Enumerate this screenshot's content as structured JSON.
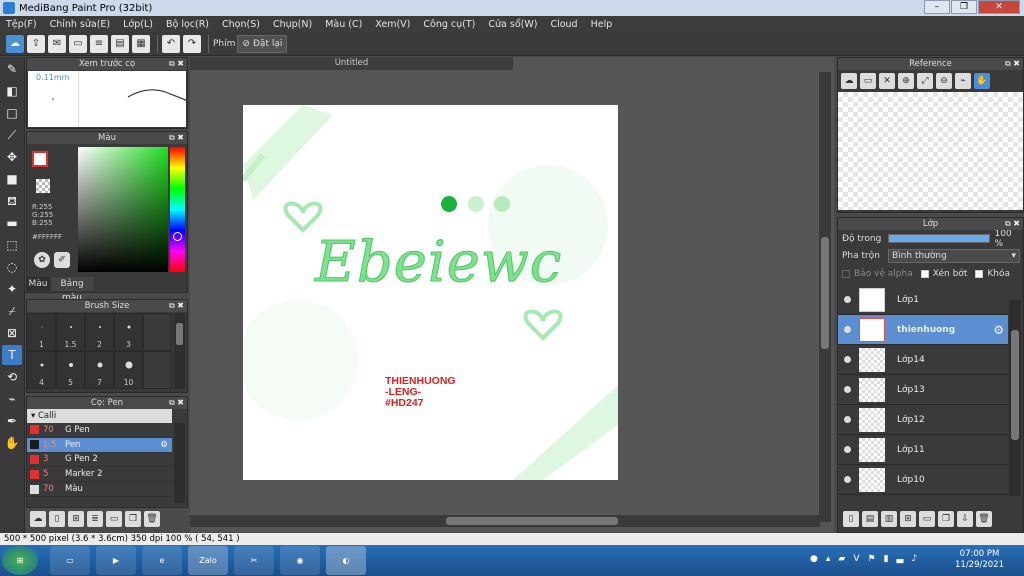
{
  "window": {
    "title": "MediBang Paint Pro (32bit)"
  },
  "menu": [
    "Tệp(F)",
    "Chỉnh sửa(E)",
    "Lớp(L)",
    "Bộ lọc(R)",
    "Chọn(S)",
    "Chụp(N)",
    "Màu (C)",
    "Xem(V)",
    "Công cụ(T)",
    "Cửa sổ(W)",
    "Cloud",
    "Help"
  ],
  "toolbar": {
    "phim_label": "Phím",
    "reset_label": "Đặt lại"
  },
  "brush_preview": {
    "title": "Xem trước cọ",
    "size_label": "0.11mm"
  },
  "color_panel": {
    "title": "Màu",
    "r": "R:255",
    "g": "G:255",
    "b": "B:255",
    "hex": "#FFFFFF",
    "tab_color": "Màu",
    "tab_palette": "Bảng màu"
  },
  "brush_size": {
    "title": "Brush Size",
    "sizes": [
      "1",
      "1.5",
      "2",
      "3",
      "4",
      "5",
      "7",
      "10"
    ]
  },
  "pen_panel": {
    "title": "Cọ: Pen",
    "group": "Calli",
    "items": [
      {
        "size": "70",
        "name": "G Pen",
        "color": "#e03030",
        "selected": false
      },
      {
        "size": "1.5",
        "name": "Pen",
        "color": "#1a1a1a",
        "selected": true
      },
      {
        "size": "3",
        "name": "G Pen 2",
        "color": "#e03030",
        "selected": false
      },
      {
        "size": "5",
        "name": "Marker 2",
        "color": "#e03030",
        "selected": false
      },
      {
        "size": "70",
        "name": "Màu",
        "color": "#dddddd",
        "selected": false
      }
    ]
  },
  "document": {
    "tab_title": "Untitled"
  },
  "artwork": {
    "word": "Ebeiewc",
    "text_lines": [
      "THIENHUONG",
      "-LENG-",
      "#HD247"
    ]
  },
  "reference_panel": {
    "title": "Reference"
  },
  "layer_panel": {
    "title": "Lớp",
    "opacity_label": "Độ trong",
    "opacity_value": "100 %",
    "opacity": 1.0,
    "blend_label": "Pha trộn",
    "blend_value": "Bình thường",
    "alpha_label": "Bảo vệ alpha",
    "clip_label": "Xén bớt",
    "lock_label": "Khóa",
    "layers": [
      {
        "name": "Lớp1",
        "selected": false
      },
      {
        "name": "thienhuong",
        "selected": true
      },
      {
        "name": "Lớp14",
        "selected": false
      },
      {
        "name": "Lớp13",
        "selected": false
      },
      {
        "name": "Lớp12",
        "selected": false
      },
      {
        "name": "Lớp11",
        "selected": false
      },
      {
        "name": "Lớp10",
        "selected": false
      }
    ]
  },
  "status_bar": {
    "text": "500 * 500 pixel  (3.6 * 3.6cm)  350 dpi  100 %  ( 54, 541 )"
  },
  "taskbar": {
    "time": "07:00 PM",
    "date": "11/29/2021",
    "zalo": "Zalo"
  },
  "colors": {
    "accent": "#5b8fd1",
    "panel_bg": "#3a3a3a",
    "art_green": "#7fe08f",
    "art_red": "#e02020"
  }
}
